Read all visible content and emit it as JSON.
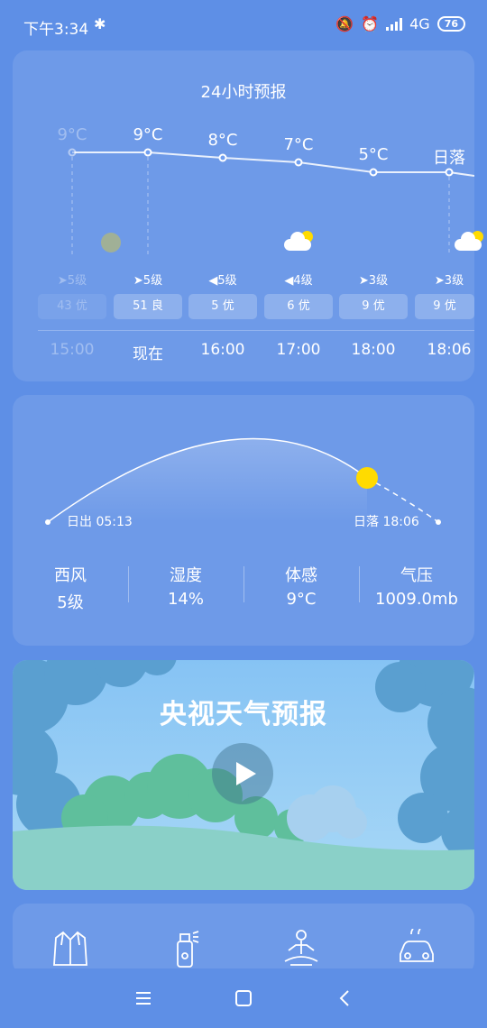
{
  "status_bar": {
    "time": "下午3:34",
    "network": "4G",
    "battery": "76"
  },
  "hourly": {
    "title": "24小时预报",
    "items": [
      {
        "temp": "9°C",
        "wind": "➤5级",
        "aqi": "43 优",
        "hour": "15:00",
        "icon": "sun-icon",
        "state": "past"
      },
      {
        "temp": "9°C",
        "wind": "➤5级",
        "aqi": "51 良",
        "hour": "现在",
        "icon": "",
        "state": "now"
      },
      {
        "temp": "8°C",
        "wind": "◀5级",
        "aqi": "5 优",
        "hour": "16:00",
        "icon": "",
        "state": "future"
      },
      {
        "temp": "7°C",
        "wind": "◀4级",
        "aqi": "6 优",
        "hour": "17:00",
        "icon": "partly-cloudy-icon",
        "state": "future"
      },
      {
        "temp": "5°C",
        "wind": "➤3级",
        "aqi": "9 优",
        "hour": "18:00",
        "icon": "",
        "state": "future"
      },
      {
        "temp": "日落",
        "wind": "➤3级",
        "aqi": "9 优",
        "hour": "18:06",
        "icon": "partly-cloudy-icon",
        "state": "future"
      }
    ]
  },
  "sun": {
    "sunrise_label": "日出 05:13",
    "sunset_label": "日落 18:06",
    "stats": [
      {
        "label": "西风",
        "value": "5级"
      },
      {
        "label": "湿度",
        "value": "14%"
      },
      {
        "label": "体感",
        "value": "9°C"
      },
      {
        "label": "气压",
        "value": "1009.0mb"
      }
    ]
  },
  "video": {
    "title": "央视天气预报"
  },
  "tips": [
    "clothing-icon",
    "spray-icon",
    "exercise-icon",
    "car-wash-icon"
  ],
  "colors": {
    "background": "#5e8fe6",
    "sun": "#ffdb00"
  }
}
